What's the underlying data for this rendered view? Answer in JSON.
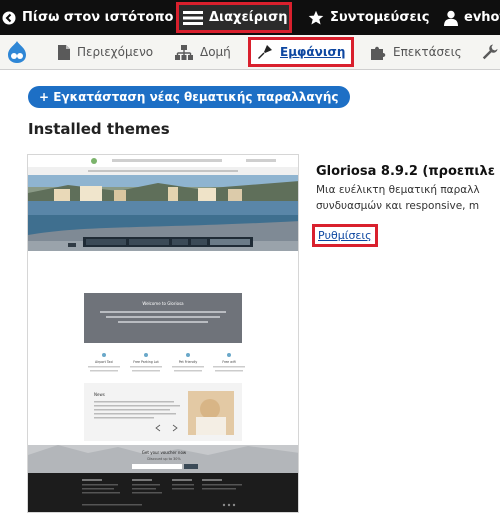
{
  "toolbar": {
    "back_label": "Πίσω στον ιστότοπο",
    "manage_label": "Διαχείριση",
    "shortcuts_label": "Συντομεύσεις",
    "user_label": "evhot"
  },
  "tray": {
    "items": [
      {
        "label": "Περιεχόμενο",
        "icon": "document-icon"
      },
      {
        "label": "Δομή",
        "icon": "structure-icon"
      },
      {
        "label": "Εμφάνιση",
        "icon": "brush-icon",
        "active": true
      },
      {
        "label": "Επεκτάσεις",
        "icon": "puzzle-icon"
      },
      {
        "label": "",
        "icon": "wrench-icon"
      }
    ]
  },
  "main": {
    "add_button": "+ Εγκατάσταση νέας θεματικής παραλλαγής",
    "heading": "Installed themes",
    "theme": {
      "title": "Gloriosa 8.9.2 (προεπιλε",
      "description_line1": "Μια ευέλικτη θεματική παραλλ",
      "description_line2": "συνδυασμών και responsive, m",
      "settings_link": "Ρυθμίσεις"
    },
    "preview": {
      "hero_heading": "Welcome to Gloriosa",
      "features": [
        "Airport Taxi",
        "Free Parking Lot",
        "Pet Friendly",
        "Free wifi"
      ],
      "news_heading": "News",
      "newsletter_line1": "Get your voucher now",
      "newsletter_line2": "Discount up to 30%"
    }
  },
  "colors": {
    "toolbar_bg": "#0f0f0f",
    "highlight_border": "#d9202d",
    "accent": "#1d6fc5",
    "link": "#0d47a1"
  }
}
